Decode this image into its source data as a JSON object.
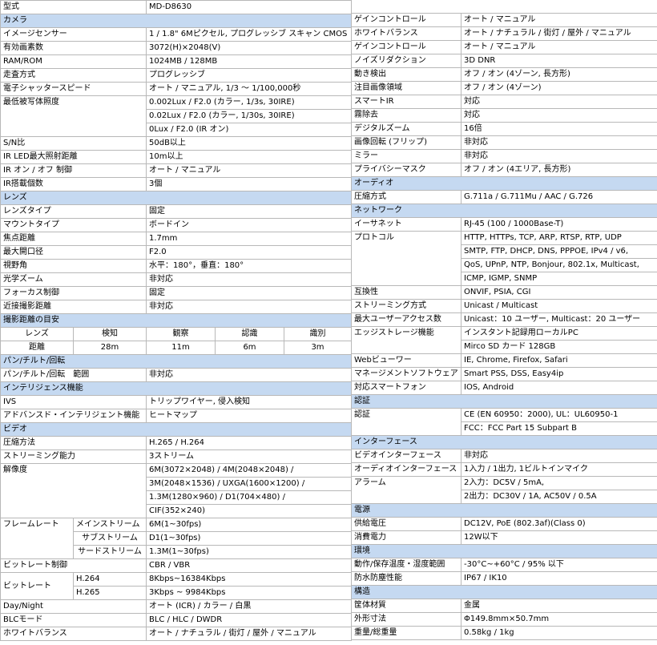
{
  "header": {
    "label": "型式",
    "model": "MD-D8630"
  },
  "camera": {
    "section": "カメラ",
    "rows": [
      [
        "イメージセンサー",
        "1 / 1.8\" 6Mピクセル, プログレッシブ スキャン CMOS"
      ],
      [
        "有効画素数",
        "3072(H)×2048(V)"
      ],
      [
        "RAM/ROM",
        "1024MB / 128MB"
      ],
      [
        "走査方式",
        "プログレッシブ"
      ],
      [
        "電子シャッタースピード",
        "オート / マニュアル, 1/3 ～ 1/100,000秒"
      ]
    ],
    "min_illum": {
      "label": "最低被写体照度",
      "values": [
        "0.002Lux / F2.0 (カラー, 1/3s, 30IRE)",
        "0.02Lux / F2.0 (カラー, 1/30s, 30IRE)",
        "0Lux / F2.0 (IR オン)"
      ]
    },
    "rows2": [
      [
        "S/N比",
        "50dB以上"
      ],
      [
        "IR LED最大照射距離",
        "10m以上"
      ],
      [
        "IR オン / オフ 制御",
        "オート / マニュアル"
      ],
      [
        "IR搭載個数",
        "3個"
      ]
    ]
  },
  "lens": {
    "section": "レンズ",
    "rows": [
      [
        "レンズタイプ",
        "固定"
      ],
      [
        "マウントタイプ",
        "ボードイン"
      ],
      [
        "焦点距離",
        "1.7mm"
      ],
      [
        "最大開口径",
        "F2.0"
      ],
      [
        "視野角",
        "水平：180°，垂直：180°"
      ],
      [
        "光学ズーム",
        "非対応"
      ],
      [
        "フォーカス制御",
        "固定"
      ],
      [
        "近接撮影距離",
        "非対応"
      ]
    ]
  },
  "distance": {
    "section": "撮影距離の目安",
    "headers": [
      "レンズ",
      "検知",
      "観察",
      "認識",
      "識別"
    ],
    "values": [
      "距離",
      "28m",
      "11m",
      "6m",
      "3m"
    ]
  },
  "ptz": {
    "section": "パン/チルト/回転",
    "rows": [
      [
        "パン/チルト/回転　範囲",
        "非対応"
      ]
    ]
  },
  "intel": {
    "section": "インテリジェンス機能",
    "rows": [
      [
        "IVS",
        "トリップワイヤー, 侵入検知"
      ],
      [
        "アドバンスド・インテリジェント機能",
        "ヒートマップ"
      ]
    ]
  },
  "video": {
    "section": "ビデオ",
    "rows": [
      [
        "圧縮方法",
        "H.265 / H.264"
      ],
      [
        "ストリーミング能力",
        "3ストリーム"
      ]
    ],
    "resolution": {
      "label": "解像度",
      "values": [
        "6M(3072×2048) / 4M(2048×2048) /",
        "3M(2048×1536) / UXGA(1600×1200) /",
        "1.3M(1280×960) / D1(704×480) /",
        "CIF(352×240)"
      ]
    },
    "framerate": {
      "label": "フレームレート",
      "rows": [
        [
          "メインストリーム",
          "6M(1~30fps)"
        ],
        [
          "サブストリーム",
          "D1(1~30fps)"
        ],
        [
          "サードストリーム",
          "1.3M(1~30fps)"
        ]
      ]
    },
    "bitrate_control": [
      "ビットレート制御",
      "CBR / VBR"
    ],
    "bitrate": {
      "label": "ビットレート",
      "rows": [
        [
          "H.264",
          "8Kbps~16384Kbps"
        ],
        [
          "H.265",
          "3Kbps ~ 9984Kbps"
        ]
      ]
    },
    "rows_end": [
      [
        "Day/Night",
        "オート (ICR) / カラー / 白黒"
      ],
      [
        "BLCモード",
        "BLC / HLC / DWDR"
      ],
      [
        "ホワイトバランス",
        "オート / ナチュラル / 街灯 / 屋外 / マニュアル"
      ]
    ]
  },
  "right": {
    "top_rows": [
      [
        "ゲインコントロール",
        "オート / マニュアル"
      ],
      [
        "ホワイトバランス",
        "オート / ナチュラル / 街灯 / 屋外 / マニュアル"
      ],
      [
        "ゲインコントロール",
        "オート / マニュアル"
      ],
      [
        "ノイズリダクション",
        "3D DNR"
      ],
      [
        "動き検出",
        "オフ / オン (4ゾーン, 長方形)"
      ],
      [
        "注目画像領域",
        "オフ / オン (4ゾーン)"
      ],
      [
        "スマートIR",
        "対応"
      ],
      [
        "霧除去",
        "対応"
      ],
      [
        "デジタルズーム",
        "16倍"
      ],
      [
        "画像回転 (フリップ)",
        "非対応"
      ],
      [
        "ミラー",
        "非対応"
      ],
      [
        "プライバシーマスク",
        "オフ / オン (4エリア, 長方形)"
      ]
    ],
    "audio": {
      "section": "オーディオ",
      "rows": [
        [
          "圧縮方式",
          "G.711a / G.711Mu / AAC / G.726"
        ]
      ]
    },
    "network": {
      "section": "ネットワーク",
      "rows": [
        [
          "イーサネット",
          "RJ-45 (100 / 1000Base-T)"
        ]
      ],
      "protocol": {
        "label": "プロトコル",
        "values": [
          "HTTP, HTTPs, TCP, ARP, RTSP, RTP, UDP",
          "SMTP, FTP, DHCP, DNS, PPPOE, IPv4 / v6,",
          "QoS, UPnP, NTP, Bonjour, 802.1x, Multicast,",
          "ICMP, IGMP, SNMP"
        ]
      },
      "rows2": [
        [
          "互換性",
          "ONVIF, PSIA, CGI"
        ],
        [
          "ストリーミング方式",
          "Unicast / Multicast"
        ],
        [
          "最大ユーザーアクセス数",
          "Unicast：10 ユーザー, Multicast：20 ユーザー"
        ]
      ],
      "edge": {
        "label": "エッジストレージ機能",
        "values": [
          "インスタント記録用ローカルPC",
          "Mirco SD カード 128GB"
        ]
      },
      "rows3": [
        [
          "Webビューワー",
          "IE, Chrome, Firefox, Safari"
        ],
        [
          "マネージメントソフトウェア",
          "Smart PSS, DSS, Easy4ip"
        ],
        [
          "対応スマートフォン",
          "IOS, Android"
        ]
      ]
    },
    "cert": {
      "section": "認証",
      "label": "認証",
      "values": [
        "CE (EN 60950：2000), UL：UL60950-1",
        "FCC：FCC Part 15 Subpart B"
      ]
    },
    "interface": {
      "section": "インターフェース",
      "rows": [
        [
          "ビデオインターフェース",
          "非対応"
        ],
        [
          "オーディオインターフェース",
          "1入力 / 1出力, 1ビルトインマイク"
        ]
      ],
      "alarm": {
        "label": "アラーム",
        "values": [
          "2入力：DC5V / 5mA,",
          "2出力：DC30V / 1A, AC50V / 0.5A"
        ]
      }
    },
    "power": {
      "section": "電源",
      "rows": [
        [
          "供給電圧",
          "DC12V, PoE (802.3af)(Class 0)"
        ],
        [
          "消費電力",
          "12W以下"
        ]
      ]
    },
    "env": {
      "section": "環境",
      "rows": [
        [
          "動作/保存温度・湿度範囲",
          "-30°C~+60°C / 95% 以下"
        ],
        [
          "防水防塵性能",
          "IP67 / IK10"
        ]
      ]
    },
    "build": {
      "section": "構造",
      "rows": [
        [
          "筐体材質",
          "金属"
        ],
        [
          "外形寸法",
          "Φ149.8mm×50.7mm"
        ],
        [
          "重量/総重量",
          "0.58kg / 1kg"
        ]
      ]
    }
  }
}
